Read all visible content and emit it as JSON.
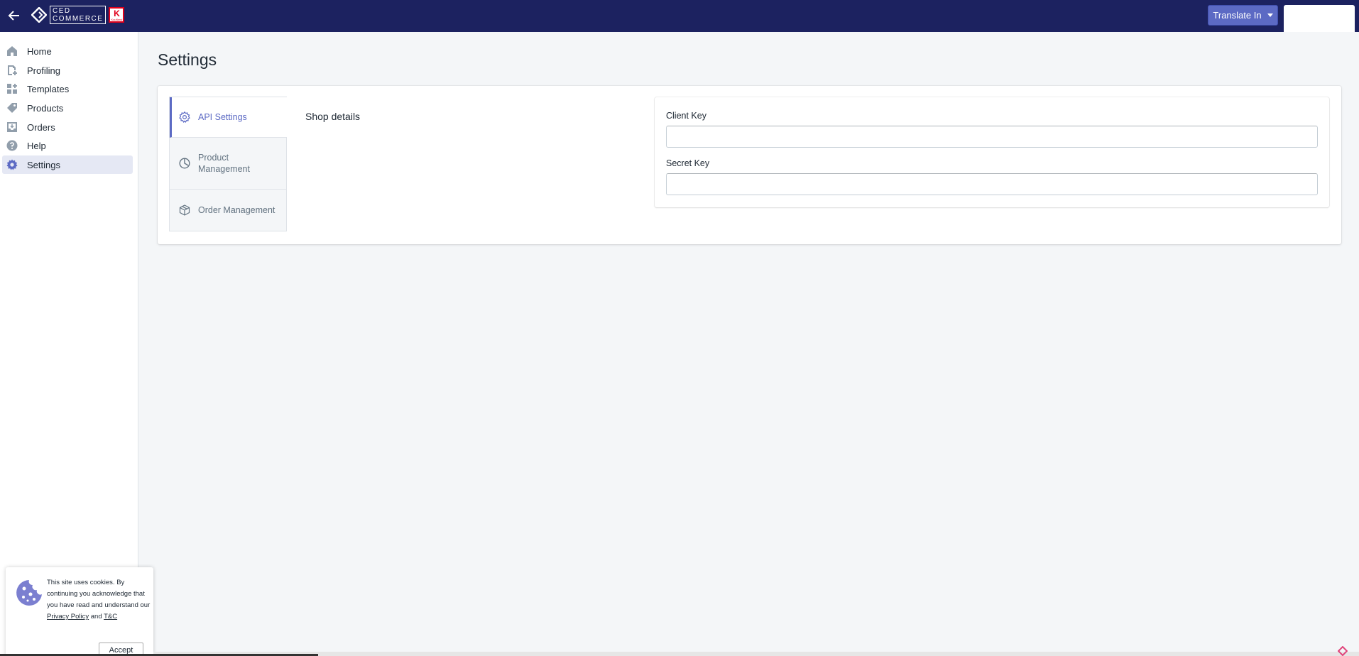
{
  "topbar": {
    "logo_text_line1": "CED",
    "logo_text_line2": "COMMERCE",
    "badge_letter": "K",
    "badge_sub": "Kaufland",
    "translate_label": "Translate In"
  },
  "sidebar": {
    "items": [
      {
        "label": "Home",
        "icon": "home-icon"
      },
      {
        "label": "Profiling",
        "icon": "profiling-icon"
      },
      {
        "label": "Templates",
        "icon": "templates-icon"
      },
      {
        "label": "Products",
        "icon": "tag-icon"
      },
      {
        "label": "Orders",
        "icon": "inbox-icon"
      },
      {
        "label": "Help",
        "icon": "question-icon"
      },
      {
        "label": "Settings",
        "icon": "gear-icon",
        "active": true
      }
    ]
  },
  "main": {
    "title": "Settings",
    "tabs": [
      {
        "label": "API Settings",
        "icon": "gear-icon",
        "active": true
      },
      {
        "label": "Product Management",
        "icon": "pie-chart-icon"
      },
      {
        "label": "Order Management",
        "icon": "box-icon"
      }
    ],
    "section_title": "Shop details",
    "fields": {
      "client_key_label": "Client Key",
      "client_key_value": "",
      "secret_key_label": "Secret Key",
      "secret_key_value": ""
    }
  },
  "cookie": {
    "text_before": "This site uses cookies. By continuing you acknowledge that you have read and understand our",
    "privacy_link": "Privacy Policy",
    "and": "and",
    "tc_link": "T&C",
    "accept_label": "Accept"
  },
  "colors": {
    "topbar": "#1c2260",
    "accent": "#5c6ac4",
    "background": "#f4f6f8"
  }
}
